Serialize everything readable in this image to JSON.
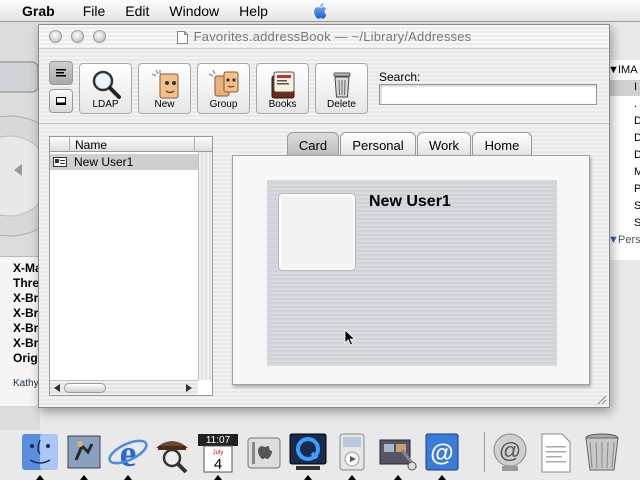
{
  "menubar": {
    "app_name": "Grab",
    "menus": [
      "File",
      "Edit",
      "Window",
      "Help"
    ]
  },
  "background": {
    "left_lines": [
      "X-Ma",
      "Thre",
      "X-Br",
      "X-Br",
      "X-Br",
      "X-Br",
      "Origi"
    ],
    "left_footer": "Kathy",
    "right_items": [
      "IMA",
      "I",
      ".",
      "D",
      "D",
      "D",
      "M",
      "P",
      "S",
      "S",
      "Pers"
    ]
  },
  "window": {
    "title": "Favorites.addressBook  —  ~/Library/Addresses"
  },
  "toolbar": {
    "buttons": [
      {
        "label": "LDAP",
        "icon": "magnifier-icon"
      },
      {
        "label": "New",
        "icon": "new-card-icon"
      },
      {
        "label": "Group",
        "icon": "group-icon"
      },
      {
        "label": "Books",
        "icon": "books-icon"
      },
      {
        "label": "Delete",
        "icon": "trash-icon"
      }
    ],
    "search_label": "Search:",
    "search_value": ""
  },
  "list": {
    "column_header": "Name",
    "rows": [
      {
        "name": "New User1",
        "selected": true
      }
    ]
  },
  "tabs": [
    {
      "label": "Card",
      "active": true
    },
    {
      "label": "Personal",
      "active": false
    },
    {
      "label": "Work",
      "active": false
    },
    {
      "label": "Home",
      "active": false
    }
  ],
  "card": {
    "name": "New User1"
  },
  "dock": {
    "clock_time": "11:07",
    "calendar_month": "July",
    "calendar_day": "4",
    "items": [
      "finder",
      "mail-app",
      "internet-explorer",
      "sherlock",
      "clock",
      "system-prefs",
      "quicktime",
      "itunes",
      "image-capture",
      "address-book",
      "mail",
      "document",
      "trash"
    ]
  },
  "colors": {
    "selection": "#cfcfcf",
    "window_bg": "#f2f2f2",
    "card_bg": "#d6d9dd"
  }
}
